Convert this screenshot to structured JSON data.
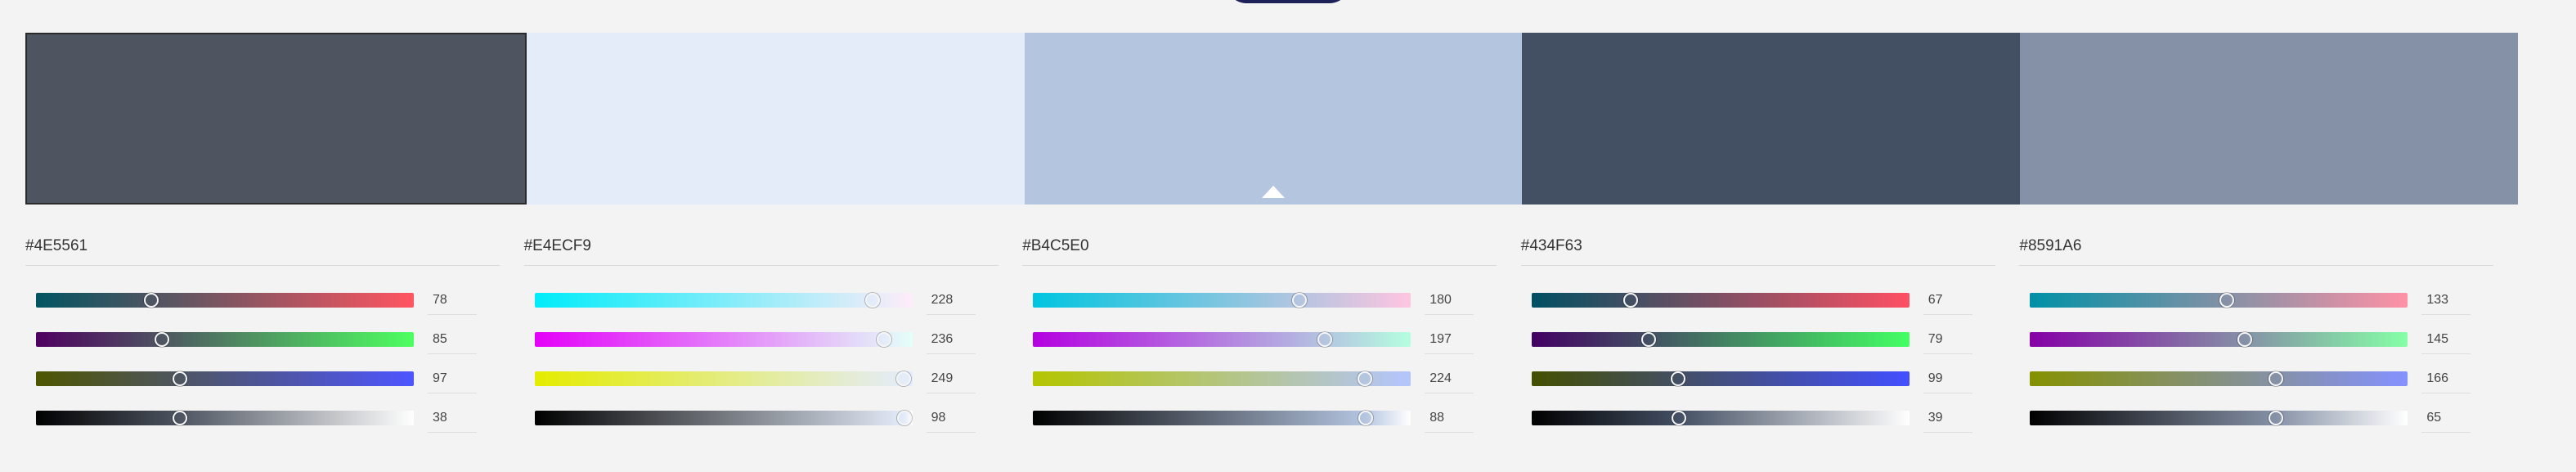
{
  "palette": {
    "selected_index": 0,
    "marker_index": 2,
    "colors": [
      {
        "hex": "#4E5561",
        "rgb": [
          78,
          85,
          97
        ],
        "k": 38
      },
      {
        "hex": "#E4ECF9",
        "rgb": [
          228,
          236,
          249
        ],
        "k": 98
      },
      {
        "hex": "#B4C5E0",
        "rgb": [
          180,
          197,
          224
        ],
        "k": 88
      },
      {
        "hex": "#434F63",
        "rgb": [
          67,
          79,
          99
        ],
        "k": 39
      },
      {
        "hex": "#8591A6",
        "rgb": [
          133,
          145,
          166
        ],
        "k": 65
      }
    ]
  }
}
